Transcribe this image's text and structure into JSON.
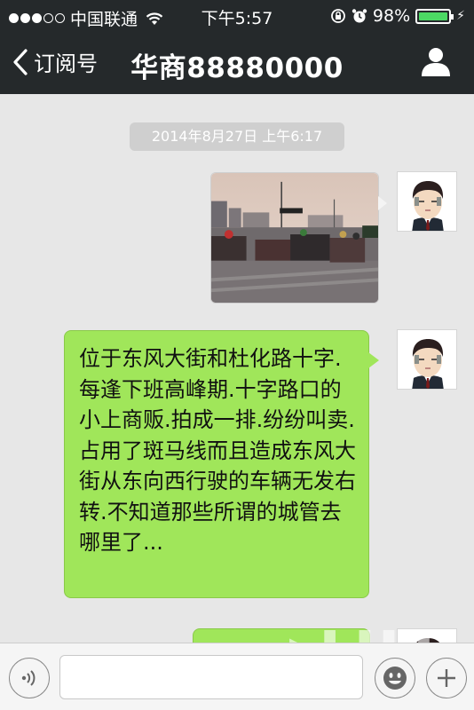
{
  "status_bar": {
    "carrier": "中国联通",
    "time": "下午5:57",
    "battery_percent": "98%",
    "battery_level": 0.98,
    "signal_filled": 3,
    "signal_total": 5
  },
  "nav": {
    "back_label": "订阅号",
    "title": "华商88880000"
  },
  "chat": {
    "timestamp": "2014年8月27日 上午6:17",
    "messages": [
      {
        "type": "image",
        "sender": "self"
      },
      {
        "type": "text",
        "sender": "self",
        "text": "位于东风大街和杜化路十字.每逢下班高峰期.十字路口的小上商贩.拍成一排.纷纷叫卖.占用了斑马线而且造成东风大街从东向西行驶的车辆无发右转.不知道那些所谓的城管去哪里了..."
      },
      {
        "type": "text",
        "sender": "self",
        "text": ""
      }
    ]
  },
  "input_bar": {
    "placeholder": "",
    "value": ""
  },
  "colors": {
    "header_bg": "#25292b",
    "chat_bg": "#e7e7e7",
    "bubble_green": "#a0e65a",
    "battery_green": "#4cd964"
  }
}
